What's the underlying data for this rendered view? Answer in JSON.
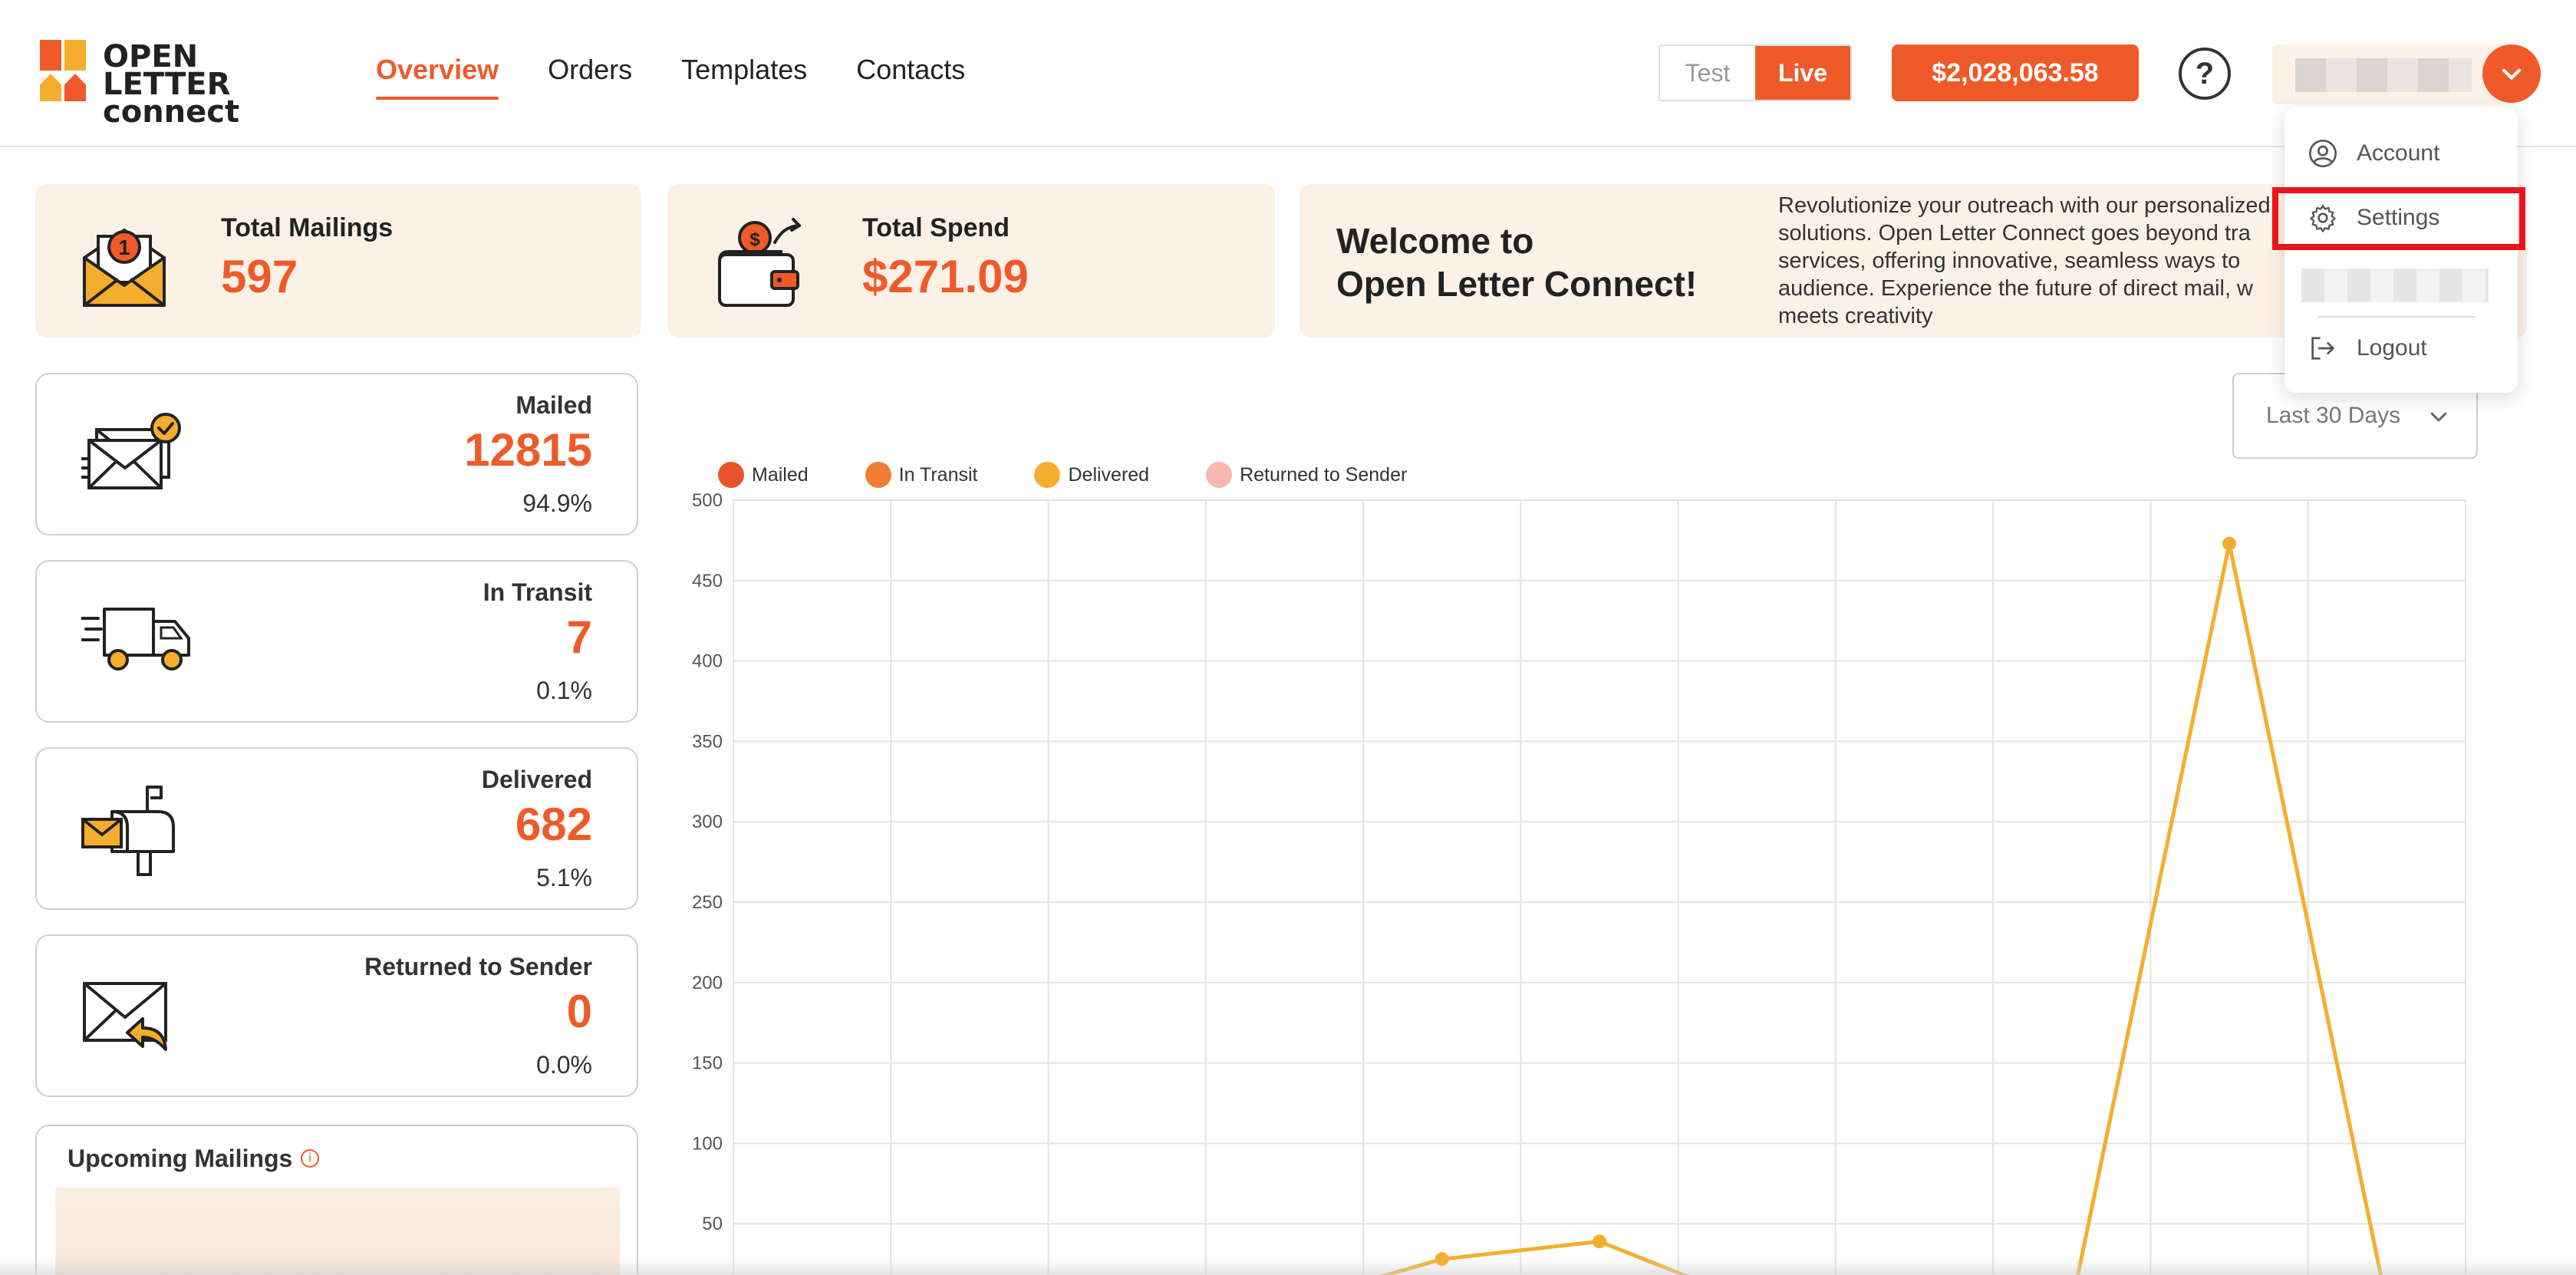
{
  "brand": {
    "line1": "OPEN LETTER",
    "line2": "connect",
    "accent": "#ef5a2a"
  },
  "nav": {
    "items": [
      {
        "label": "Overview",
        "active": true
      },
      {
        "label": "Orders",
        "active": false
      },
      {
        "label": "Templates",
        "active": false
      },
      {
        "label": "Contacts",
        "active": false
      }
    ]
  },
  "mode": {
    "test": "Test",
    "live": "Live",
    "selected": "Live"
  },
  "balance": "$2,028,063.58",
  "help": "?",
  "user_menu": {
    "items": [
      {
        "label": "Account",
        "icon": "user-circle-icon"
      },
      {
        "label": "Settings",
        "icon": "gear-icon"
      },
      {
        "label": "Logout",
        "icon": "logout-icon"
      }
    ]
  },
  "summary": {
    "total_mailings": {
      "label": "Total Mailings",
      "value": "597",
      "icon": "envelope-badge-icon"
    },
    "total_spend": {
      "label": "Total Spend",
      "value": "$271.09",
      "icon": "wallet-icon"
    },
    "welcome": {
      "title_line1": "Welcome to",
      "title_line2": "Open Letter Connect!",
      "text": "Revolutionize your outreach with our personalized\nsolutions. Open Letter Connect goes beyond tra\nservices, offering innovative, seamless ways to\naudience. Experience the future of direct mail, w\nmeets creativity"
    }
  },
  "statuses": [
    {
      "label": "Mailed",
      "value": "12815",
      "percent": "94.9%",
      "icon": "mailed-envelopes-icon"
    },
    {
      "label": "In Transit",
      "value": "7",
      "percent": "0.1%",
      "icon": "delivery-truck-icon"
    },
    {
      "label": "Delivered",
      "value": "682",
      "percent": "5.1%",
      "icon": "mailbox-icon"
    },
    {
      "label": "Returned to Sender",
      "value": "0",
      "percent": "0.0%",
      "icon": "return-envelope-icon"
    }
  ],
  "upcoming": {
    "title": "Upcoming Mailings",
    "info_icon": "i"
  },
  "chart_filter": {
    "selected": "Last 30 Days"
  },
  "chart_data": {
    "type": "line",
    "legend_position": "top-left",
    "grid": true,
    "ylim": [
      0,
      500
    ],
    "y_ticks": [
      50,
      100,
      150,
      200,
      250,
      300,
      350,
      400,
      450,
      500
    ],
    "x_categories": 11,
    "series": [
      {
        "name": "Mailed",
        "color": "#e8532a",
        "values": []
      },
      {
        "name": "In Transit",
        "color": "#f07d34",
        "values": []
      },
      {
        "name": "Delivered",
        "color": "#f5ad2e",
        "values": [
          0,
          0,
          0,
          0,
          28,
          39,
          0,
          0,
          0,
          473,
          0
        ]
      },
      {
        "name": "Returned to Sender",
        "color": "#f7b8b0",
        "values": []
      }
    ]
  }
}
